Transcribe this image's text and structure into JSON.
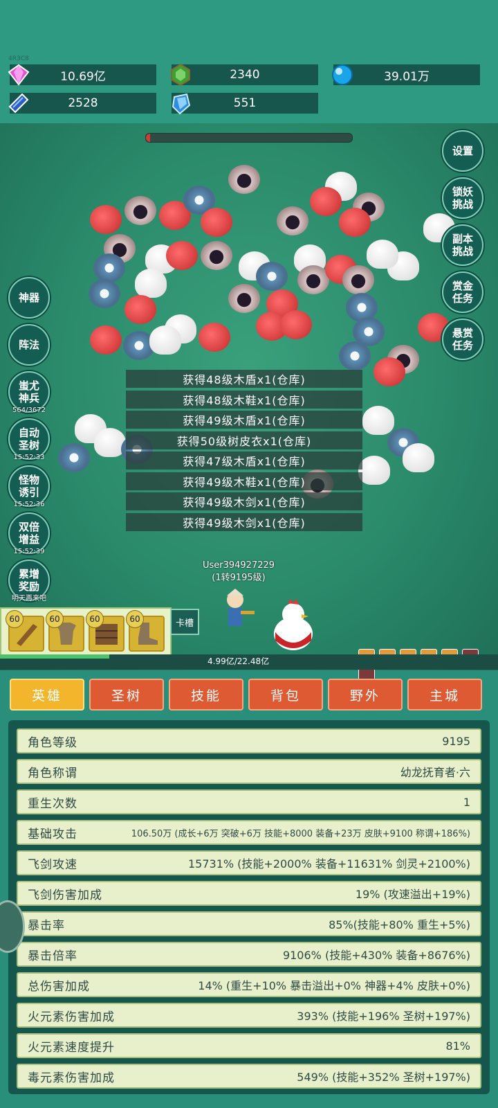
{
  "header": {
    "version": "4R3C8",
    "resources": [
      {
        "icon": "diamond-icon",
        "value": "10.69亿"
      },
      {
        "icon": "green-gem-icon",
        "value": "2340"
      },
      {
        "icon": "blue-orb-icon",
        "value": "39.01万"
      },
      {
        "icon": "book-icon",
        "value": "2528"
      },
      {
        "icon": "crystal-icon",
        "value": "551"
      }
    ]
  },
  "side_right": {
    "settings": "设置",
    "demon_lock": "锁妖挑战",
    "dungeon": "副本挑战",
    "bounty": "赏金任务",
    "reward": "悬赏任务"
  },
  "side_left": {
    "artifact": "神器",
    "formation": "阵法",
    "chiyou": {
      "label": "蚩尤神兵",
      "sub": "564/3672"
    },
    "auto_tree": {
      "label": "自动圣树",
      "sub": "15:52:33"
    },
    "lure": {
      "label": "怪物诱引",
      "sub": "15:52:36"
    },
    "double": {
      "label": "双倍增益",
      "sub": "15:52:39"
    },
    "accum": {
      "label": "累增奖励",
      "sub": "明天再来吧"
    }
  },
  "loot_messages": [
    "获得48级木盾x1(仓库)",
    "获得48级木鞋x1(仓库)",
    "获得49级木盾x1(仓库)",
    "获得50级树皮衣x1(仓库)",
    "获得47级木盾x1(仓库)",
    "获得49级木鞋x1(仓库)",
    "获得49级木剑x1(仓库)",
    "获得49级木剑x1(仓库)"
  ],
  "player": {
    "name": "User394927229",
    "level": "(1转9195级)"
  },
  "equipment": [
    {
      "level": "60",
      "icon": "sword-icon"
    },
    {
      "level": "60",
      "icon": "armor-icon"
    },
    {
      "level": "60",
      "icon": "shield-icon"
    },
    {
      "level": "60",
      "icon": "boot-icon"
    }
  ],
  "card_slot": "卡槽",
  "exp_text": "4.99亿/22.48亿",
  "exp_progress": 0.22,
  "tabs": [
    "英雄",
    "圣树",
    "技能",
    "背包",
    "野外",
    "主城"
  ],
  "active_tab": "英雄",
  "stats": [
    {
      "k": "角色等级",
      "v": "9195"
    },
    {
      "k": "角色称谓",
      "v": "幼龙抚育者·六"
    },
    {
      "k": "重生次数",
      "v": "1"
    },
    {
      "k": "基础攻击",
      "v": "106.50万 (成长+6万 突破+6万 技能+8000 装备+23万 皮肤+9100 称谓+186%)"
    },
    {
      "k": "飞剑攻速",
      "v": "15731% (技能+2000% 装备+11631% 剑灵+2100%)"
    },
    {
      "k": "飞剑伤害加成",
      "v": "19% (攻速溢出+19%)"
    },
    {
      "k": "暴击率",
      "v": "85%(技能+80% 重生+5%)"
    },
    {
      "k": "暴击倍率",
      "v": "9106% (技能+430% 装备+8676%)"
    },
    {
      "k": "总伤害加成",
      "v": "14% (重生+10% 暴击溢出+0% 神器+4% 皮肤+0%)"
    },
    {
      "k": "火元素伤害加成",
      "v": "393% (技能+196% 圣树+197%)"
    },
    {
      "k": "火元素速度提升",
      "v": "81%"
    },
    {
      "k": "毒元素伤害加成",
      "v": "549% (技能+352% 圣树+197%)"
    }
  ]
}
